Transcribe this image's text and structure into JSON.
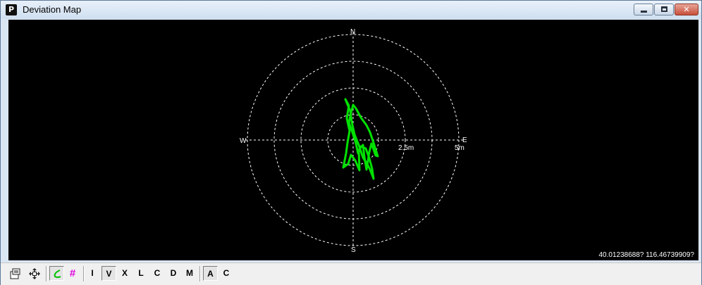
{
  "window": {
    "title": "Deviation Map",
    "app_icon_letter": "P",
    "buttons": {
      "minimize": "",
      "maximize": "",
      "close": "✕"
    }
  },
  "map": {
    "north_label": "N",
    "south_label": "S",
    "east_label": "E",
    "west_label": "W",
    "ring_labels": [
      "2.5m",
      "5m"
    ],
    "coordinate_readout": "40.01238688? 116.46739909?",
    "track_color": "#00e000",
    "grid_color": "#ffffff"
  },
  "toolbar": {
    "properties_icon": "properties-icon",
    "pan_icon": "pan-move-icon",
    "track_icon": "track-curve-icon",
    "grid_icon": "grid-hash-icon",
    "grid_symbol": "#",
    "i_label": "I",
    "v_label": "V",
    "x_label": "X",
    "l_label": "L",
    "c_label": "C",
    "d_label": "D",
    "m_label": "M",
    "a_label": "A",
    "c2_label": "C"
  }
}
